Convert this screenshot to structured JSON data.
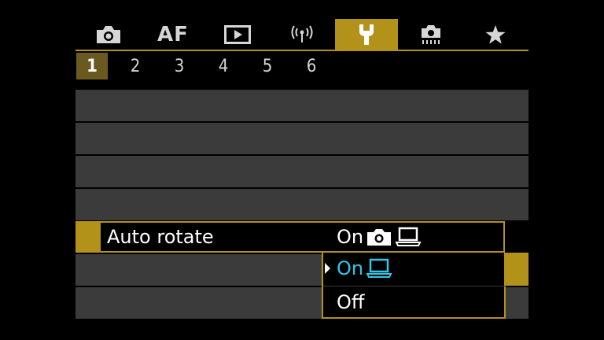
{
  "tabs": [
    {
      "icon": "camera-icon",
      "active": false
    },
    {
      "label": "AF",
      "active": false
    },
    {
      "icon": "playback-icon",
      "active": false
    },
    {
      "icon": "wireless-icon",
      "active": false
    },
    {
      "icon": "wrench-icon",
      "active": true
    },
    {
      "icon": "custom-function-icon",
      "active": false
    },
    {
      "icon": "star-icon",
      "active": false
    }
  ],
  "subtabs": [
    "1",
    "2",
    "3",
    "4",
    "5",
    "6"
  ],
  "active_subtab": "1",
  "menu_item": {
    "label": "Auto rotate",
    "current_value": "On",
    "current_value_icons": [
      "camera-icon",
      "computer-icon"
    ]
  },
  "dropdown": {
    "options": [
      {
        "label": "On",
        "icons": [
          "computer-icon"
        ],
        "highlighted": true
      },
      {
        "label": "Off",
        "icons": [],
        "highlighted": false
      }
    ]
  },
  "colors": {
    "accent": "#b3921a",
    "highlight_text": "#2ec8e6",
    "row_background": "#3b3b3b",
    "background": "#000000"
  }
}
